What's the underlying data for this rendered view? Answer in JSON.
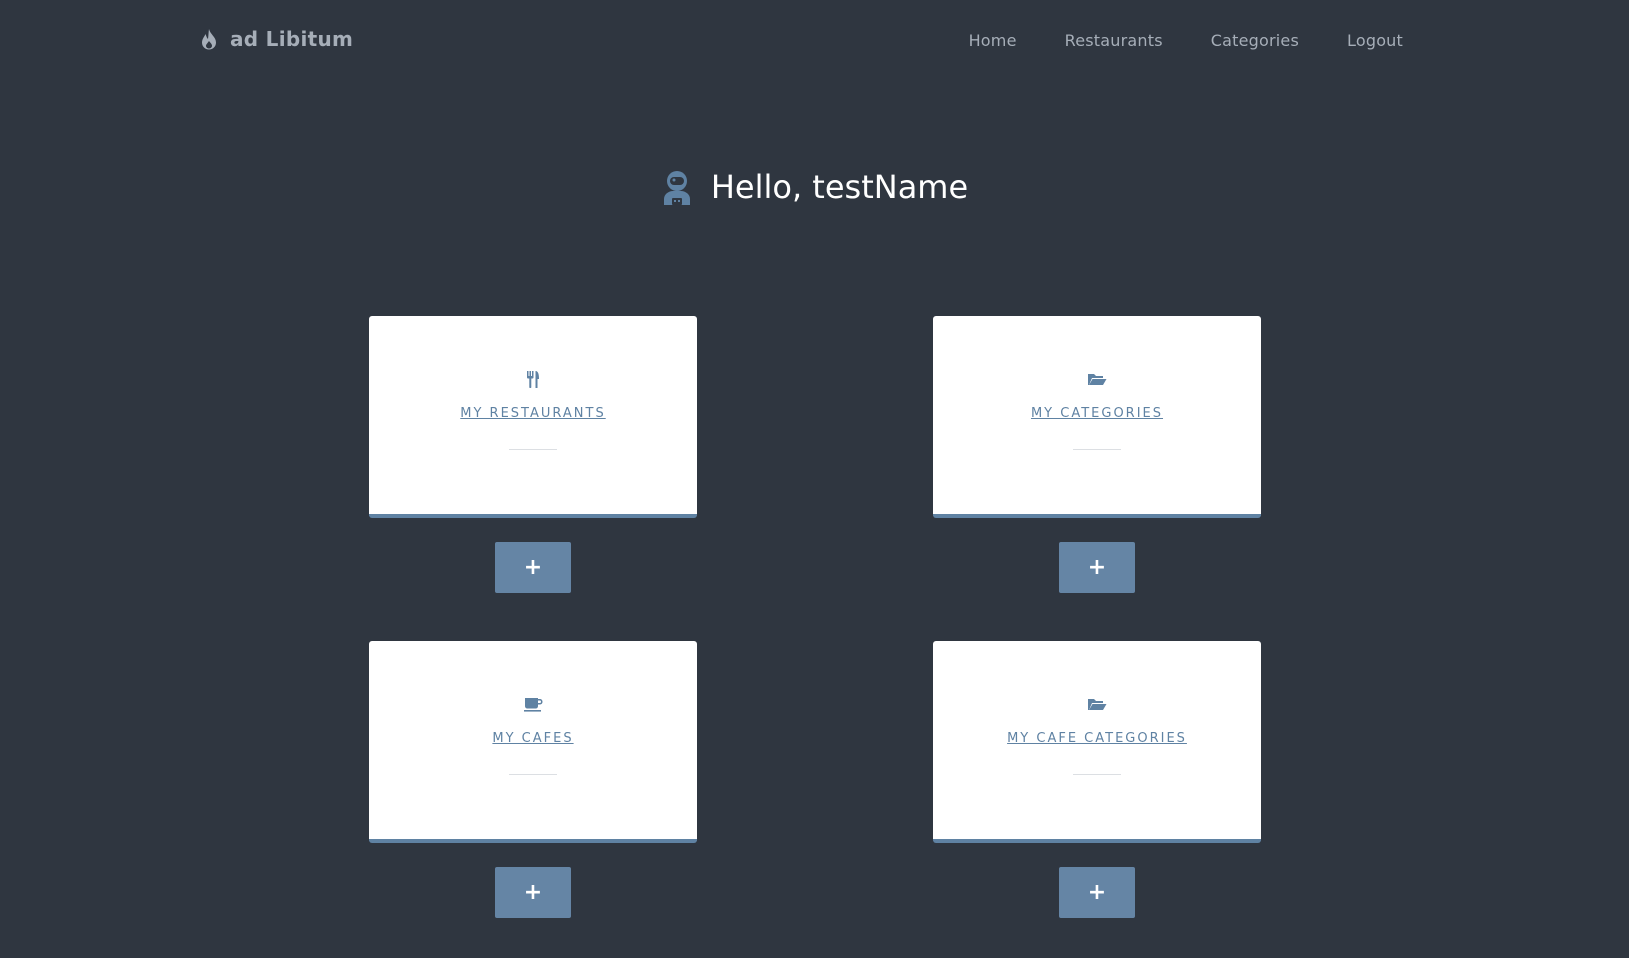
{
  "navbar": {
    "brand": {
      "text": "ad Libitum",
      "icon": "flame-icon"
    },
    "links": [
      {
        "label": "Home"
      },
      {
        "label": "Restaurants"
      },
      {
        "label": "Categories"
      },
      {
        "label": "Logout"
      }
    ]
  },
  "greeting": {
    "text": "Hello, testName",
    "icon": "user-astronaut-icon"
  },
  "cards": [
    {
      "label": "MY RESTAURANTS",
      "icon": "utensils-icon",
      "add_label": "+"
    },
    {
      "label": "MY CATEGORIES",
      "icon": "folder-open-icon",
      "add_label": "+"
    },
    {
      "label": "MY CAFES",
      "icon": "coffee-icon",
      "add_label": "+"
    },
    {
      "label": "MY CAFE CATEGORIES",
      "icon": "folder-open-icon",
      "add_label": "+"
    }
  ],
  "colors": {
    "background": "#2f3640",
    "accent": "#5f82a3",
    "nav_text": "#a6aeb8",
    "card_background": "#ffffff"
  }
}
